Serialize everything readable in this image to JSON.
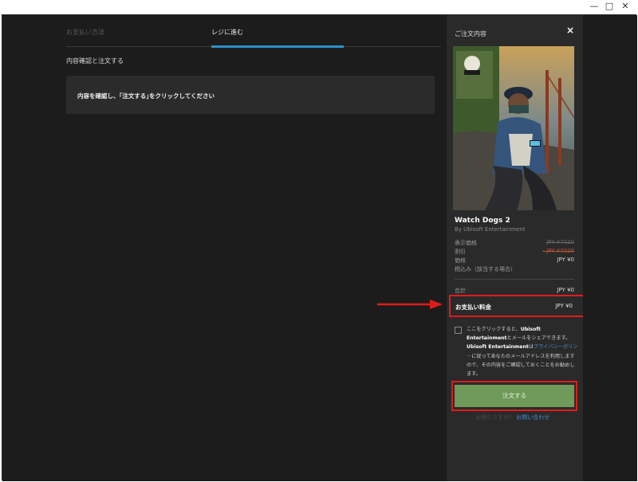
{
  "window_controls": {
    "minimize": "—",
    "maximize": "□",
    "close": "✕"
  },
  "tabs": [
    {
      "label": "お支払い方法",
      "active": false
    },
    {
      "label": "レジに進む",
      "active": true
    }
  ],
  "main": {
    "section_title": "内容確認と注文する",
    "confirm_text": "内容を確認し、｢注文する｣をクリックしてください"
  },
  "sidebar": {
    "title": "ご注文内容",
    "close_icon": "×",
    "game": {
      "title": "Watch Dogs 2",
      "publisher": "By Ubisoft Entertainment"
    },
    "prices": {
      "list_label": "表示価格",
      "list_value": "JPY ¥7020",
      "discount_label": "割引",
      "discount_value": "- JPY ¥7020",
      "price_label": "価格",
      "price_value": "JPY ¥0",
      "tax_label": "税込み（該当する場合）",
      "total_label": "合計",
      "total_value": "JPY ¥0"
    },
    "payment": {
      "label": "お支払い料金",
      "value": "JPY ¥0"
    },
    "consent": {
      "part1": "ここをクリックすると、",
      "company1": "Ubisoft Entertainment",
      "part2": "とメールをシェアできます。",
      "company2": "Ubisoft Entertainment",
      "part3": "は",
      "privacy_link": "プライバシーポリシー",
      "part4": "に従ってあなたのメールアドレスを利用しますので、その内容をご確認しておくことをお勧めします。"
    },
    "order_button": "注文する",
    "help_text": "お困りですか？",
    "help_link": "お問い合わせ"
  },
  "colors": {
    "background": "#1c1c1c",
    "sidebar": "#2a2a2a",
    "accent_tab": "#2f8fc8",
    "order_button": "#6f9a5a",
    "highlight": "#e01b1b",
    "link": "#4a8fd0"
  }
}
